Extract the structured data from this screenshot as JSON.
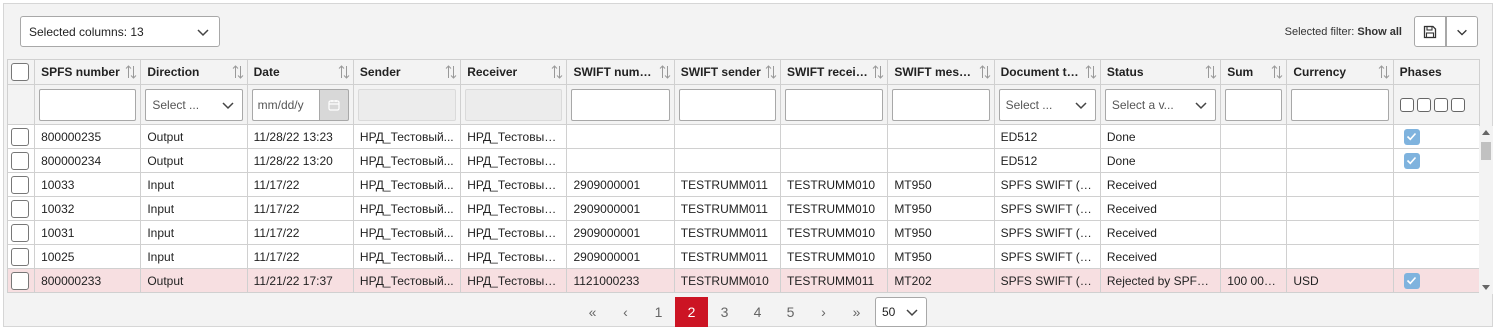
{
  "toolbar": {
    "columns_selector": "Selected columns: 13",
    "filter_label": "Selected filter:",
    "filter_value": "Show all"
  },
  "columns": [
    "SPFS number",
    "Direction",
    "Date",
    "Sender",
    "Receiver",
    "SWIFT number",
    "SWIFT sender",
    "SWIFT receiver",
    "SWIFT messag...",
    "Document type",
    "Status",
    "Sum",
    "Currency",
    "Phases"
  ],
  "filters": {
    "direction_placeholder": "Select ...",
    "date_placeholder": "mm/dd/y",
    "doc_type_placeholder": "Select ...",
    "status_placeholder": "Select a v..."
  },
  "rows": [
    {
      "spfs": "800000235",
      "direction": "Output",
      "date": "11/28/22 13:23",
      "sender": "НРД_Тестовый...",
      "receiver": "НРД_Тестовый...",
      "swift_number": "",
      "swift_sender": "",
      "swift_receiver": "",
      "swift_msg": "",
      "doc_type": "ED512",
      "status": "Done",
      "sum": "",
      "currency": "",
      "phase": true,
      "highlight": false
    },
    {
      "spfs": "800000234",
      "direction": "Output",
      "date": "11/28/22 13:20",
      "sender": "НРД_Тестовый...",
      "receiver": "НРД_Тестовый...",
      "swift_number": "",
      "swift_sender": "",
      "swift_receiver": "",
      "swift_msg": "",
      "doc_type": "ED512",
      "status": "Done",
      "sum": "",
      "currency": "",
      "phase": true,
      "highlight": false
    },
    {
      "spfs": "10033",
      "direction": "Input",
      "date": "11/17/22",
      "sender": "НРД_Тестовый...",
      "receiver": "НРД_Тестовый...",
      "swift_number": "2909000001",
      "swift_sender": "TESTRUMM011",
      "swift_receiver": "TESTRUMM010",
      "swift_msg": "MT950",
      "doc_type": "SPFS SWIFT (ED...",
      "status": "Received",
      "sum": "",
      "currency": "",
      "phase": false,
      "highlight": false
    },
    {
      "spfs": "10032",
      "direction": "Input",
      "date": "11/17/22",
      "sender": "НРД_Тестовый...",
      "receiver": "НРД_Тестовый...",
      "swift_number": "2909000001",
      "swift_sender": "TESTRUMM011",
      "swift_receiver": "TESTRUMM010",
      "swift_msg": "MT950",
      "doc_type": "SPFS SWIFT (ED...",
      "status": "Received",
      "sum": "",
      "currency": "",
      "phase": false,
      "highlight": false
    },
    {
      "spfs": "10031",
      "direction": "Input",
      "date": "11/17/22",
      "sender": "НРД_Тестовый...",
      "receiver": "НРД_Тестовый...",
      "swift_number": "2909000001",
      "swift_sender": "TESTRUMM011",
      "swift_receiver": "TESTRUMM010",
      "swift_msg": "MT950",
      "doc_type": "SPFS SWIFT (ED...",
      "status": "Received",
      "sum": "",
      "currency": "",
      "phase": false,
      "highlight": false
    },
    {
      "spfs": "10025",
      "direction": "Input",
      "date": "11/17/22",
      "sender": "НРД_Тестовый...",
      "receiver": "НРД_Тестовый...",
      "swift_number": "2909000001",
      "swift_sender": "TESTRUMM011",
      "swift_receiver": "TESTRUMM010",
      "swift_msg": "MT950",
      "doc_type": "SPFS SWIFT (ED...",
      "status": "Received",
      "sum": "",
      "currency": "",
      "phase": false,
      "highlight": false
    },
    {
      "spfs": "800000233",
      "direction": "Output",
      "date": "11/21/22 17:37",
      "sender": "НРД_Тестовый...",
      "receiver": "НРД_Тестовый...",
      "swift_number": "1121000233",
      "swift_sender": "TESTRUMM010",
      "swift_receiver": "TESTRUMM011",
      "swift_msg": "MT202",
      "doc_type": "SPFS SWIFT (ED...",
      "status": "Rejected by SPFS ...",
      "sum": "100 000...",
      "currency": "USD",
      "phase": true,
      "highlight": true
    }
  ],
  "pagination": {
    "first": "«",
    "prev": "‹",
    "pages": [
      "1",
      "2",
      "3",
      "4",
      "5"
    ],
    "current": "2",
    "next": "›",
    "last": "»",
    "page_size": "50"
  },
  "colors": {
    "accent": "#cc1424",
    "row_highlight": "#f7dfe1",
    "checkbox_checked": "#7fb3de"
  }
}
